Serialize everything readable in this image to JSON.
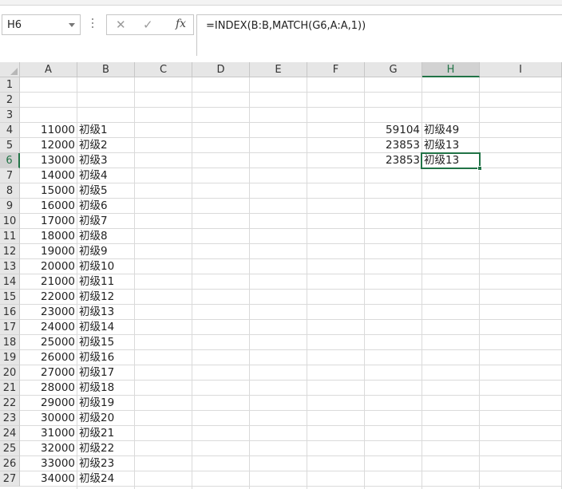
{
  "name_box": {
    "value": "H6"
  },
  "formula_bar": {
    "formula": "=INDEX(B:B,MATCH(G6,A:A,1))",
    "fx_label": "fx"
  },
  "columns": [
    "A",
    "B",
    "C",
    "D",
    "E",
    "F",
    "G",
    "H",
    "I"
  ],
  "selected_column": "H",
  "selected_row": "6",
  "rows": [
    "1",
    "2",
    "3",
    "4",
    "5",
    "6",
    "7",
    "8",
    "9",
    "10",
    "11",
    "12",
    "13",
    "14",
    "15",
    "16",
    "17",
    "18",
    "19",
    "20",
    "21",
    "22",
    "23",
    "24",
    "25",
    "26",
    "27"
  ],
  "col_a": [
    "",
    "",
    "",
    "11000",
    "12000",
    "13000",
    "14000",
    "15000",
    "16000",
    "17000",
    "18000",
    "19000",
    "20000",
    "21000",
    "22000",
    "23000",
    "24000",
    "25000",
    "26000",
    "27000",
    "28000",
    "29000",
    "30000",
    "31000",
    "32000",
    "33000",
    "34000"
  ],
  "col_b": [
    "",
    "",
    "",
    "初级1",
    "初级2",
    "初级3",
    "初级4",
    "初级5",
    "初级6",
    "初级7",
    "初级8",
    "初级9",
    "初级10",
    "初级11",
    "初级12",
    "初级13",
    "初级14",
    "初级15",
    "初级16",
    "初级17",
    "初级18",
    "初级19",
    "初级20",
    "初级21",
    "初级22",
    "初级23",
    "初级24"
  ],
  "lookup": {
    "g4": "59104",
    "h4": "初级49",
    "g5": "23853",
    "h5": "初级13",
    "g6": "23853",
    "h6": "初级13"
  },
  "colors": {
    "accent": "#217346",
    "header_bg": "#e6e6e6",
    "gridline": "#dadada"
  }
}
